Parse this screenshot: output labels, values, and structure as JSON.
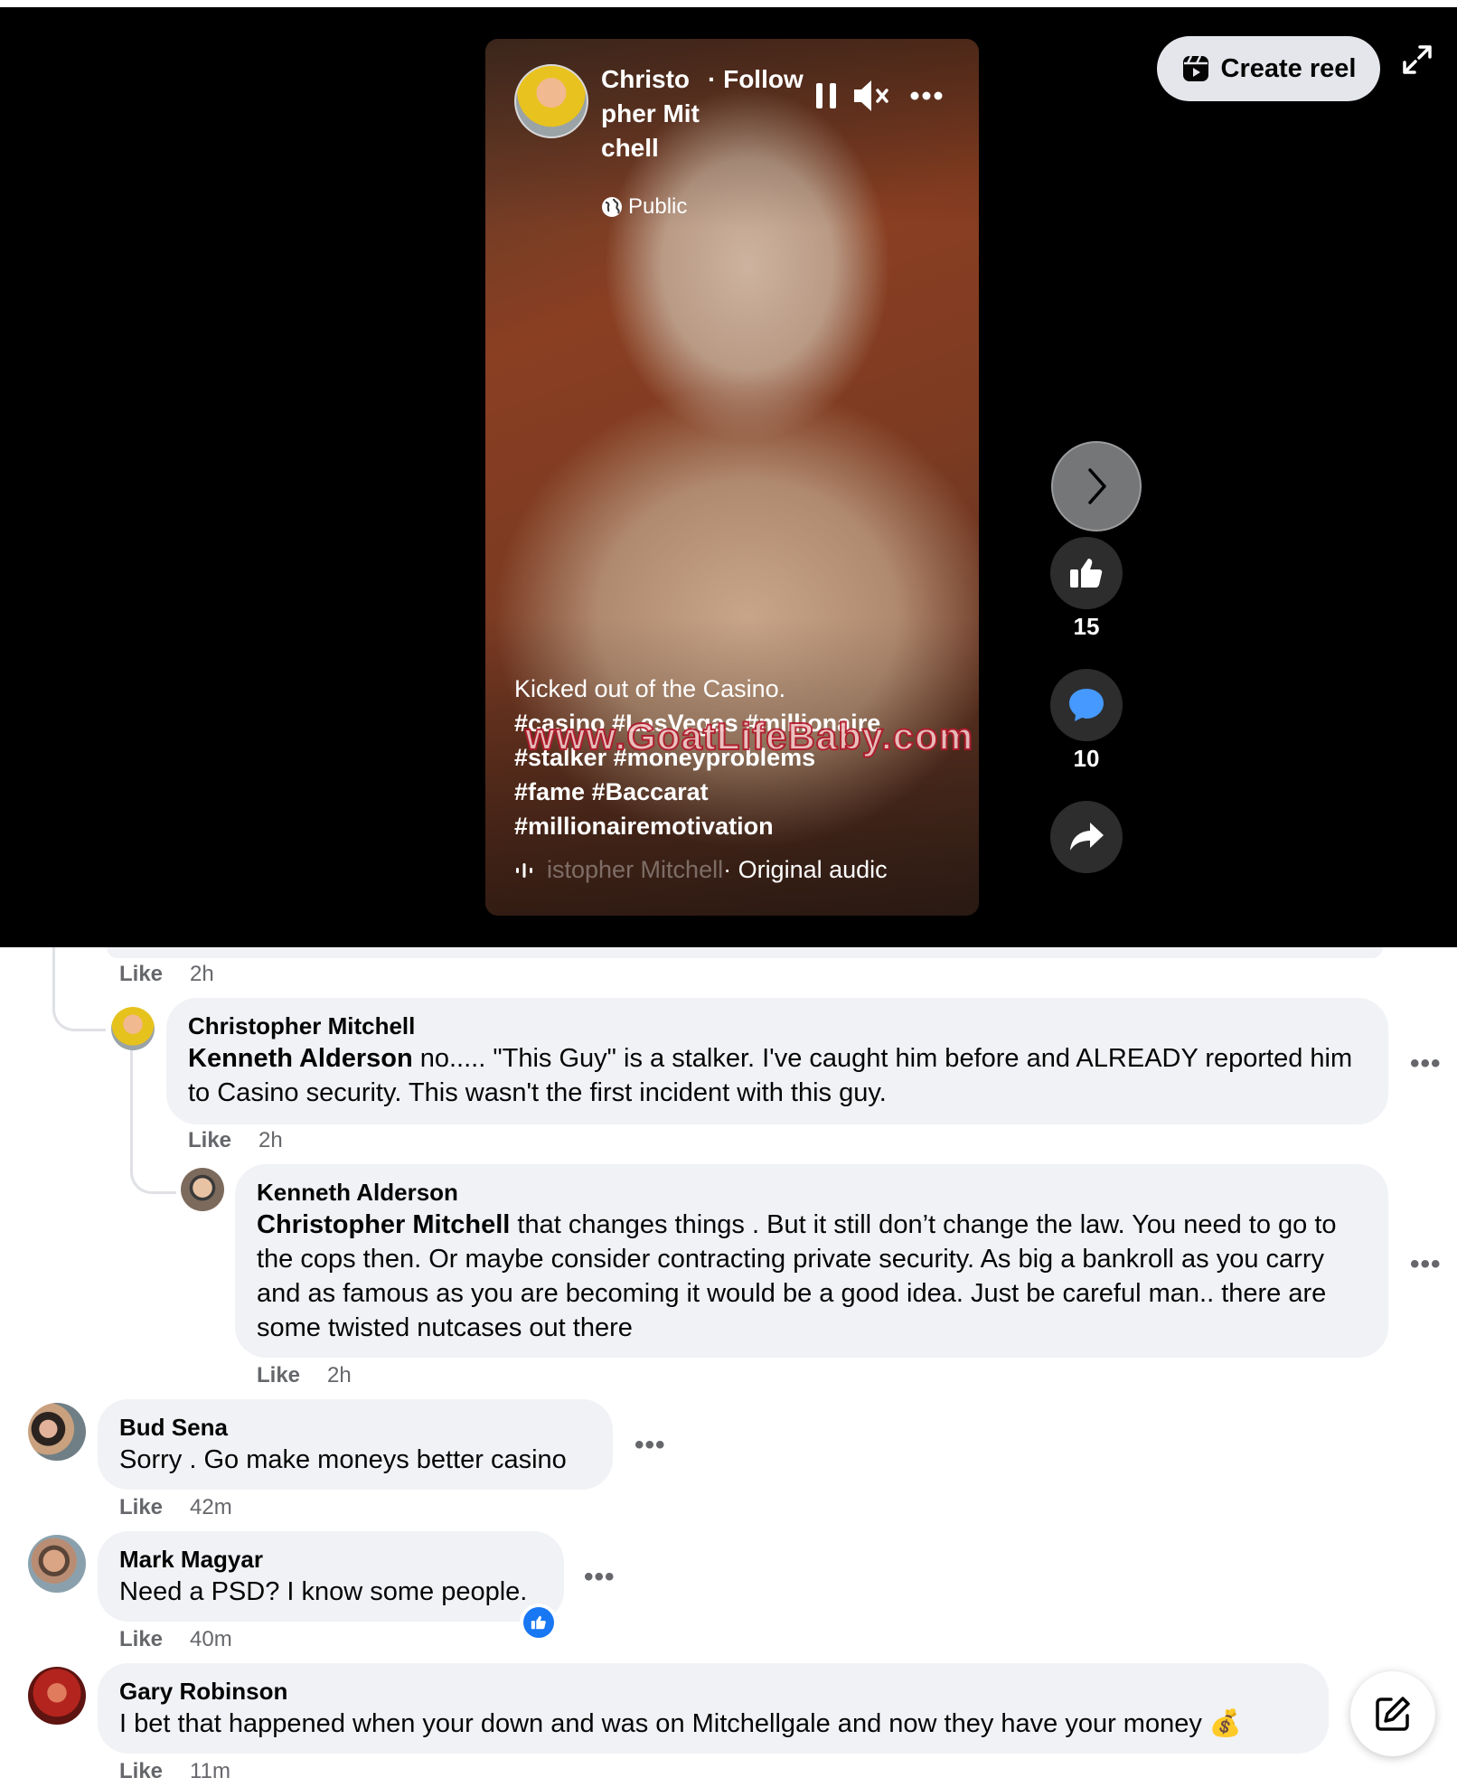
{
  "reel": {
    "author_name": "Christopher Mitchell",
    "follow_label": "· Follow",
    "privacy": "Public",
    "caption_line": "Kicked out of the Casino.",
    "hashtags_line1": "#casino #LasVegas #millionaire",
    "hashtags_line2": "#stalker #moneyproblems",
    "hashtags_line3": "#fame #Baccarat",
    "hashtags_line4": "#millionairemotivation",
    "watermark": "www.GoatLifeBaby.com",
    "audio_fade": "istopher Mitchell",
    "audio_text": "· Original audic",
    "create_reel_label": "Create reel",
    "like_count": "15",
    "comment_count": "10"
  },
  "comments": {
    "prev_meta": {
      "like": "Like",
      "time": "2h"
    },
    "c1": {
      "author": "Christopher Mitchell",
      "mention": "Kenneth Alderson",
      "text": " no..... \"This Guy\" is a stalker. I've caught him before and ALREADY reported him to Casino security. This wasn't the first incident with this guy.",
      "like": "Like",
      "time": "2h"
    },
    "c2": {
      "author": "Kenneth Alderson",
      "mention": "Christopher Mitchell",
      "text": " that changes things . But it still don’t change the law. You need to go to the cops then. Or maybe consider contracting private security. As big a bankroll as you carry and as famous as you are becoming it would be a good idea. Just be careful man.. there are some twisted nutcases out there",
      "like": "Like",
      "time": "2h"
    },
    "c3": {
      "author": "Bud Sena",
      "text": "Sorry . Go make moneys better casino",
      "like": "Like",
      "time": "42m"
    },
    "c4": {
      "author": "Mark Magyar",
      "text": "Need a PSD? I know some people.",
      "like": "Like",
      "time": "40m"
    },
    "c5": {
      "author": "Gary Robinson",
      "text": "I bet that happened when your down and was on Mitchellgale and now they have your money 💰",
      "like": "Like",
      "time": "11m"
    },
    "more": "•••"
  }
}
